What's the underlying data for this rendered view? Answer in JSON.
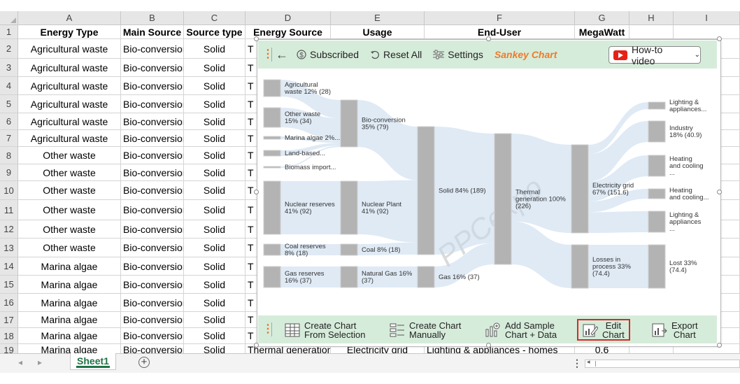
{
  "columns": [
    "A",
    "B",
    "C",
    "D",
    "E",
    "F",
    "G",
    "H",
    "I"
  ],
  "headers": {
    "a": "Energy Type",
    "b": "Main Source",
    "c": "Source type",
    "d": "Energy Source",
    "e": "Usage",
    "f": "End-User",
    "g": "MegaWatt"
  },
  "rows": [
    {
      "n": "2",
      "a": "Agricultural waste",
      "b": "Bio-conversion",
      "c": "Solid",
      "d": "T"
    },
    {
      "n": "3",
      "a": "Agricultural waste",
      "b": "Bio-conversion",
      "c": "Solid",
      "d": "T"
    },
    {
      "n": "4",
      "a": "Agricultural waste",
      "b": "Bio-conversion",
      "c": "Solid",
      "d": "T"
    },
    {
      "n": "5",
      "a": "Agricultural waste",
      "b": "Bio-conversion",
      "c": "Solid",
      "d": "T"
    },
    {
      "n": "6",
      "a": "Agricultural waste",
      "b": "Bio-conversion",
      "c": "Solid",
      "d": "T"
    },
    {
      "n": "7",
      "a": "Agricultural waste",
      "b": "Bio-conversion",
      "c": "Solid",
      "d": "T"
    },
    {
      "n": "8",
      "a": "Other waste",
      "b": "Bio-conversion",
      "c": "Solid",
      "d": "T"
    },
    {
      "n": "9",
      "a": "Other waste",
      "b": "Bio-conversion",
      "c": "Solid",
      "d": "T"
    },
    {
      "n": "10",
      "a": "Other waste",
      "b": "Bio-conversion",
      "c": "Solid",
      "d": "T"
    },
    {
      "n": "11",
      "a": "Other waste",
      "b": "Bio-conversion",
      "c": "Solid",
      "d": "T"
    },
    {
      "n": "12",
      "a": "Other waste",
      "b": "Bio-conversion",
      "c": "Solid",
      "d": "T"
    },
    {
      "n": "13",
      "a": "Other waste",
      "b": "Bio-conversion",
      "c": "Solid",
      "d": "T"
    },
    {
      "n": "14",
      "a": "Marina algae",
      "b": "Bio-conversion",
      "c": "Solid",
      "d": "T"
    },
    {
      "n": "15",
      "a": "Marina algae",
      "b": "Bio-conversion",
      "c": "Solid",
      "d": "T"
    },
    {
      "n": "16",
      "a": "Marina algae",
      "b": "Bio-conversion",
      "c": "Solid",
      "d": "T"
    },
    {
      "n": "17",
      "a": "Marina algae",
      "b": "Bio-conversion",
      "c": "Solid",
      "d": "T"
    },
    {
      "n": "18",
      "a": "Marina algae",
      "b": "Bio-conversion",
      "c": "Solid",
      "d": "T"
    },
    {
      "n": "19",
      "a": "Marina algae",
      "b": "Bio-conversion",
      "c": "Solid",
      "d": "Thermal generation",
      "e": "Electricity grid",
      "f": "Lighting & appliances - homes",
      "g": "0.6"
    }
  ],
  "sheet_tab": "Sheet1",
  "panel": {
    "subscribed": "Subscribed",
    "reset_all": "Reset All",
    "settings": "Settings",
    "title": "Sankey Chart",
    "howto": "How-to video",
    "create_from_selection": [
      "Create Chart",
      "From Selection"
    ],
    "create_manually": [
      "Create Chart",
      "Manually"
    ],
    "add_sample": [
      "Add Sample",
      "Chart + Data"
    ],
    "edit_chart": [
      "Edit",
      "Chart"
    ],
    "export_chart": [
      "Export",
      "Chart"
    ]
  },
  "watermark": "PPCexpo",
  "chart_data": {
    "type": "sankey",
    "nodes": [
      {
        "id": "agri",
        "label": [
          "Agricultural",
          "waste 12% (28)"
        ],
        "col": 0,
        "value": 28
      },
      {
        "id": "otherw",
        "label": [
          "Other waste",
          "15% (34)"
        ],
        "col": 0,
        "value": 34
      },
      {
        "id": "marina",
        "label": [
          "Marina algae 2%..."
        ],
        "col": 0,
        "value": 4
      },
      {
        "id": "land",
        "label": [
          "Land-based..."
        ],
        "col": 0,
        "value": 4
      },
      {
        "id": "biomass",
        "label": [
          "Biomass import..."
        ],
        "col": 0,
        "value": 2
      },
      {
        "id": "nuclearr",
        "label": [
          "Nuclear reserves",
          "41% (92)"
        ],
        "col": 0,
        "value": 92
      },
      {
        "id": "coalr",
        "label": [
          "Coal reserves",
          "8% (18)"
        ],
        "col": 0,
        "value": 18
      },
      {
        "id": "gasr",
        "label": [
          "Gas reserves",
          "16% (37)"
        ],
        "col": 0,
        "value": 37
      },
      {
        "id": "bio",
        "label": [
          "Bio-conversion",
          "35% (79)"
        ],
        "col": 1,
        "value": 79
      },
      {
        "id": "nplant",
        "label": [
          "Nuclear Plant",
          "41% (92)"
        ],
        "col": 1,
        "value": 92
      },
      {
        "id": "coal",
        "label": [
          "Coal 8% (18)"
        ],
        "col": 1,
        "value": 18
      },
      {
        "id": "ngas",
        "label": [
          "Natural Gas 16%",
          "(37)"
        ],
        "col": 1,
        "value": 37
      },
      {
        "id": "solid",
        "label": [
          "Solid 84% (189)"
        ],
        "col": 2,
        "value": 189
      },
      {
        "id": "gas",
        "label": [
          "Gas 16% (37)"
        ],
        "col": 2,
        "value": 37
      },
      {
        "id": "thermal",
        "label": [
          "Thermal",
          "generation 100%",
          "(226)"
        ],
        "col": 3,
        "value": 226
      },
      {
        "id": "grid",
        "label": [
          "Electricity grid",
          "67% (151.6)"
        ],
        "col": 4,
        "value": 151.6
      },
      {
        "id": "loss",
        "label": [
          "Losses in",
          "process 33%",
          "(74.4)"
        ],
        "col": 4,
        "value": 74.4
      },
      {
        "id": "light1",
        "label": [
          "Lighting &",
          "appliances..."
        ],
        "col": 5,
        "value": 14
      },
      {
        "id": "industry",
        "label": [
          "Industry",
          "18% (40.9)"
        ],
        "col": 5,
        "value": 40.9
      },
      {
        "id": "heat1",
        "label": [
          "Heating",
          "and cooling",
          "..."
        ],
        "col": 5,
        "value": 30
      },
      {
        "id": "heat2",
        "label": [
          "Heating",
          "and cooling..."
        ],
        "col": 5,
        "value": 16
      },
      {
        "id": "light2",
        "label": [
          "Lighting &",
          "appliances",
          "..."
        ],
        "col": 5,
        "value": 31
      },
      {
        "id": "lost",
        "label": [
          "Lost 33%",
          "(74.4)"
        ],
        "col": 5,
        "value": 74.4
      }
    ],
    "links": [
      [
        "agri",
        "bio"
      ],
      [
        "otherw",
        "bio"
      ],
      [
        "marina",
        "bio"
      ],
      [
        "land",
        "bio"
      ],
      [
        "biomass",
        "bio"
      ],
      [
        "nuclearr",
        "nplant"
      ],
      [
        "coalr",
        "coal"
      ],
      [
        "gasr",
        "ngas"
      ],
      [
        "bio",
        "solid"
      ],
      [
        "nplant",
        "solid"
      ],
      [
        "coal",
        "solid"
      ],
      [
        "ngas",
        "gas"
      ],
      [
        "solid",
        "thermal"
      ],
      [
        "gas",
        "thermal"
      ],
      [
        "thermal",
        "grid"
      ],
      [
        "thermal",
        "loss"
      ],
      [
        "grid",
        "light1"
      ],
      [
        "grid",
        "industry"
      ],
      [
        "grid",
        "heat1"
      ],
      [
        "grid",
        "heat2"
      ],
      [
        "grid",
        "light2"
      ],
      [
        "loss",
        "lost"
      ]
    ]
  }
}
